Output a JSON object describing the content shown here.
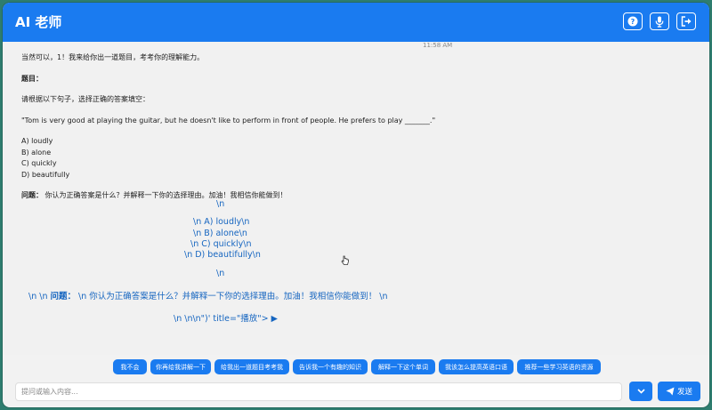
{
  "app": {
    "title": "AI 老师"
  },
  "header_icons": [
    "help-icon",
    "microphone-icon",
    "logout-icon"
  ],
  "chat": {
    "timestamp": "11:58 AM",
    "intro": "当然可以，1！我来给你出一道题目，考考你的理解能力。",
    "question_heading": "题目：",
    "instruction": "请根据以下句子，选择正确的答案填空：",
    "sentence": "\"Tom is very good at playing the guitar, but he doesn't like to perform in front of people. He prefers to play _______.\"",
    "options": [
      "A) loudly",
      "B) alone",
      "C) quickly",
      "D) beautifully"
    ],
    "question_label": "问题：",
    "question_text": "你认为正确答案是什么？并解释一下你的选择理由。加油！我相信你能做到！",
    "raw": {
      "line1": "\\n",
      "line2": "\\n A) loudly\\n",
      "line3": "\\n B) alone\\n",
      "line4": "\\n C) quickly\\n",
      "line5": "\\n D) beautifully\\n",
      "line6": "\\n",
      "line7_prefix": "\\n \\n ",
      "line7_bold": "问题：",
      "line7_rest": " \\n 你认为正确答案是什么？并解释一下你的选择理由。加油！我相信你能做到！ \\n",
      "line8": "\\n \\n\\n\")' title=\"播放\"> ▶"
    }
  },
  "suggestions": [
    "我不会",
    "你再给我讲解一下",
    "给我出一道题目考考我",
    "告诉我一个有趣的知识",
    "解释一下这个单词",
    "我该怎么提高英语口语",
    "推荐一些学习英语的资源"
  ],
  "input": {
    "placeholder": "提问或输入内容..."
  },
  "send_label": "发送",
  "colors": {
    "accent": "#1a7bf0",
    "link_blue": "#1565c0"
  }
}
